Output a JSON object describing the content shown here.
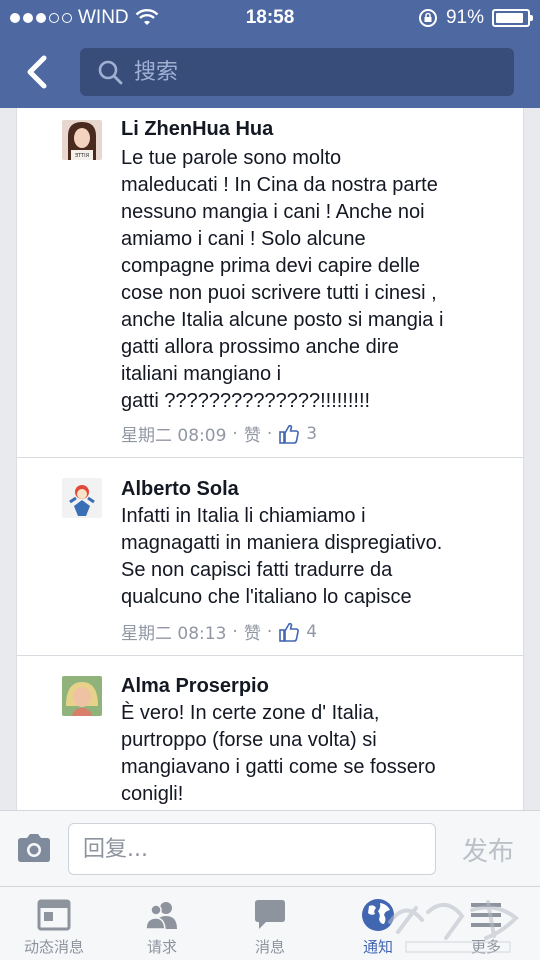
{
  "status_bar": {
    "carrier": "WIND",
    "time": "18:58",
    "battery": "91%",
    "battery_level": 0.91,
    "signal_bars_filled": 3,
    "signal_bars_total": 5
  },
  "nav": {
    "search_placeholder": "搜索"
  },
  "comments": [
    {
      "author": "Li ZhenHua Hua",
      "text": "Le tue parole sono molto\nmaleducati ! In Cina da nostra parte\nnessuno mangia i cani ! Anche noi\namiamo i cani !  Solo alcune\ncompagne prima devi capire delle\ncose non puoi scrivere tutti i cinesi ,\nanche Italia alcune posto si mangia i\ngatti allora prossimo anche dire\nitaliani mangiano i\ngatti ??????????????!!!!!!!!!",
      "time": "星期二 08:09",
      "like_label": "赞",
      "likes": "3"
    },
    {
      "author": "Alberto Sola",
      "text": "Infatti in Italia li chiamiamo i\nmagnagatti in maniera dispregiativo.\nSe non capisci fatti tradurre da\nqualcuno che l'italiano lo capisce",
      "time": "星期二 08:13",
      "like_label": "赞",
      "likes": "4"
    },
    {
      "author": "Alma Proserpio",
      "text": "È vero! In certe zone d' Italia,\npurtroppo (forse una volta) si\nmangiavano i gatti come se fossero\nconigli!"
    }
  ],
  "reply_bar": {
    "placeholder": "回复...",
    "send_label": "发布"
  },
  "tabs": [
    {
      "label": "动态消息",
      "icon": "news-feed-icon"
    },
    {
      "label": "请求",
      "icon": "friend-requests-icon"
    },
    {
      "label": "消息",
      "icon": "messages-icon"
    },
    {
      "label": "通知",
      "icon": "notifications-globe-icon",
      "active": true
    },
    {
      "label": "更多",
      "icon": "more-menu-icon"
    }
  ],
  "colors": {
    "brand_blue": "#4e69a2",
    "search_bg": "#384d7a",
    "active_tab": "#4267b2"
  }
}
